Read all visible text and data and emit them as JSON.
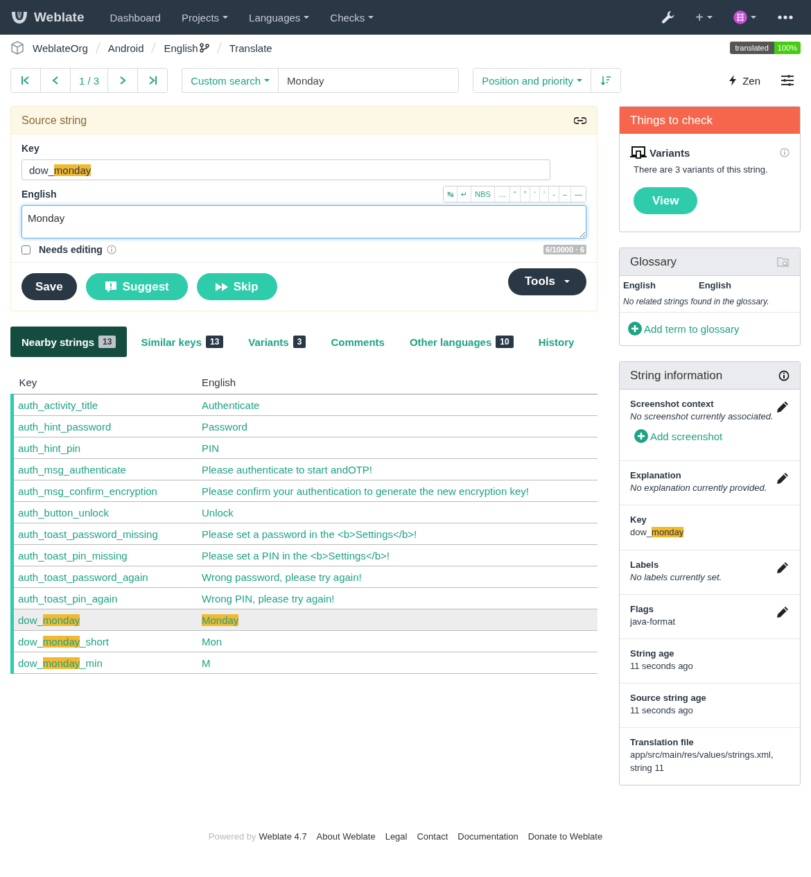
{
  "navbar": {
    "brand": "Weblate",
    "menu": [
      {
        "label": "Dashboard",
        "dropdown": false
      },
      {
        "label": "Projects",
        "dropdown": true
      },
      {
        "label": "Languages",
        "dropdown": true
      },
      {
        "label": "Checks",
        "dropdown": true
      }
    ],
    "add": "+"
  },
  "breadcrumbs": [
    {
      "label": "WeblateOrg",
      "kind": "plain"
    },
    {
      "label": "Android",
      "kind": "plain"
    },
    {
      "label": "English",
      "kind": "branch"
    },
    {
      "label": "Translate",
      "kind": "plain"
    }
  ],
  "badge": {
    "label": "translated",
    "value": "100%"
  },
  "pager": {
    "position": "1 / 3"
  },
  "search": {
    "filter": "Custom search",
    "query": "Monday"
  },
  "sort": {
    "label": "Position and priority"
  },
  "zen": {
    "label": "Zen"
  },
  "source": {
    "title": "Source string",
    "key_label": "Key",
    "key": [
      {
        "text": "dow_",
        "highlight": false
      },
      {
        "text": "monday",
        "highlight": true
      }
    ],
    "language_label": "English",
    "specials": [
      "↹",
      "↵",
      "NBS",
      "…",
      "“",
      "”",
      "‘",
      "’",
      "-",
      "–",
      "—"
    ],
    "translation": "Monday",
    "needs_editing": {
      "label": "Needs editing",
      "checked": false
    },
    "counter": "6/10000 · 6",
    "buttons": [
      {
        "label": "Save",
        "kind": "save"
      },
      {
        "label": "Suggest",
        "kind": "suggest"
      },
      {
        "label": "Skip",
        "kind": "skip"
      }
    ],
    "tools": "Tools"
  },
  "tabs": [
    {
      "label": "Nearby strings",
      "count": "13",
      "selected": true
    },
    {
      "label": "Similar keys",
      "count": "13",
      "selected": false
    },
    {
      "label": "Variants",
      "count": "3",
      "selected": false
    },
    {
      "label": "Comments",
      "selected": false
    },
    {
      "label": "Other languages",
      "count": "10",
      "selected": false
    },
    {
      "label": "History",
      "selected": false
    }
  ],
  "table": {
    "columns": [
      "Key",
      "English"
    ],
    "rows": [
      {
        "key": [
          {
            "text": "auth_activity_title",
            "highlight": false
          }
        ],
        "english": [
          {
            "text": "Authenticate",
            "highlight": false
          }
        ],
        "selected": false
      },
      {
        "key": [
          {
            "text": "auth_hint_password",
            "highlight": false
          }
        ],
        "english": [
          {
            "text": "Password",
            "highlight": false
          }
        ],
        "selected": false
      },
      {
        "key": [
          {
            "text": "auth_hint_pin",
            "highlight": false
          }
        ],
        "english": [
          {
            "text": "PIN",
            "highlight": false
          }
        ],
        "selected": false
      },
      {
        "key": [
          {
            "text": "auth_msg_authenticate",
            "highlight": false
          }
        ],
        "english": [
          {
            "text": "Please authenticate to start andOTP!",
            "highlight": false
          }
        ],
        "selected": false
      },
      {
        "key": [
          {
            "text": "auth_msg_confirm_encryption",
            "highlight": false
          }
        ],
        "english": [
          {
            "text": "Please confirm your authentication to generate the new encryption key!",
            "highlight": false
          }
        ],
        "selected": false
      },
      {
        "key": [
          {
            "text": "auth_button_unlock",
            "highlight": false
          }
        ],
        "english": [
          {
            "text": "Unlock",
            "highlight": false
          }
        ],
        "selected": false
      },
      {
        "key": [
          {
            "text": "auth_toast_password_missing",
            "highlight": false
          }
        ],
        "english": [
          {
            "text": "Please set a password in the <b>Settings</b>!",
            "highlight": false
          }
        ],
        "selected": false
      },
      {
        "key": [
          {
            "text": "auth_toast_pin_missing",
            "highlight": false
          }
        ],
        "english": [
          {
            "text": "Please set a PIN in the <b>Settings</b>!",
            "highlight": false
          }
        ],
        "selected": false
      },
      {
        "key": [
          {
            "text": "auth_toast_password_again",
            "highlight": false
          }
        ],
        "english": [
          {
            "text": "Wrong password, please try again!",
            "highlight": false
          }
        ],
        "selected": false
      },
      {
        "key": [
          {
            "text": "auth_toast_pin_again",
            "highlight": false
          }
        ],
        "english": [
          {
            "text": "Wrong PIN, please try again!",
            "highlight": false
          }
        ],
        "selected": false
      },
      {
        "key": [
          {
            "text": "dow_",
            "highlight": false
          },
          {
            "text": "monday",
            "highlight": true
          }
        ],
        "english": [
          {
            "text": "Monday",
            "highlight": true
          }
        ],
        "selected": true
      },
      {
        "key": [
          {
            "text": "dow_",
            "highlight": false
          },
          {
            "text": "monday",
            "highlight": true
          },
          {
            "text": "_short",
            "highlight": false
          }
        ],
        "english": [
          {
            "text": "Mon",
            "highlight": false
          }
        ],
        "selected": false
      },
      {
        "key": [
          {
            "text": "dow_",
            "highlight": false
          },
          {
            "text": "monday",
            "highlight": true
          },
          {
            "text": "_min",
            "highlight": false
          }
        ],
        "english": [
          {
            "text": "M",
            "highlight": false
          }
        ],
        "selected": false
      }
    ]
  },
  "checks": {
    "title": "Things to check",
    "items": [
      {
        "name": "Variants",
        "description": "There are 3 variants of this string.",
        "action": "View"
      }
    ]
  },
  "glossary": {
    "title": "Glossary",
    "columns": [
      "English",
      "English"
    ],
    "empty": "No related strings found in the glossary.",
    "add": "Add term to glossary"
  },
  "info": {
    "title": "String information",
    "sections": [
      {
        "label": "Screenshot context",
        "value": [
          {
            "text": "No screenshot currently associated.",
            "highlight": false
          }
        ],
        "italic": true,
        "editable": true,
        "action": "Add screenshot"
      },
      {
        "label": "Explanation",
        "value": [
          {
            "text": "No explanation currently provided.",
            "highlight": false
          }
        ],
        "italic": true,
        "editable": true
      },
      {
        "label": "Key",
        "value": [
          {
            "text": "dow_",
            "highlight": false
          },
          {
            "text": "monday",
            "highlight": true
          }
        ],
        "italic": false,
        "editable": false
      },
      {
        "label": "Labels",
        "value": [
          {
            "text": "No labels currently set.",
            "highlight": false
          }
        ],
        "italic": true,
        "editable": true
      },
      {
        "label": "Flags",
        "value": [
          {
            "text": "java-format",
            "highlight": false
          }
        ],
        "italic": false,
        "editable": true
      },
      {
        "label": "String age",
        "value": [
          {
            "text": "11 seconds ago",
            "highlight": false
          }
        ],
        "italic": false,
        "editable": false
      },
      {
        "label": "Source string age",
        "value": [
          {
            "text": "11 seconds ago",
            "highlight": false
          }
        ],
        "italic": false,
        "editable": false
      },
      {
        "label": "Translation file",
        "value": [
          {
            "text": "app/src/main/res/values/strings.xml, string 11",
            "highlight": false
          }
        ],
        "italic": false,
        "editable": false
      }
    ]
  },
  "footer": {
    "powered_by": "Powered by",
    "links": [
      "Weblate 4.7",
      "About Weblate",
      "Legal",
      "Contact",
      "Documentation",
      "Donate to Weblate"
    ]
  }
}
